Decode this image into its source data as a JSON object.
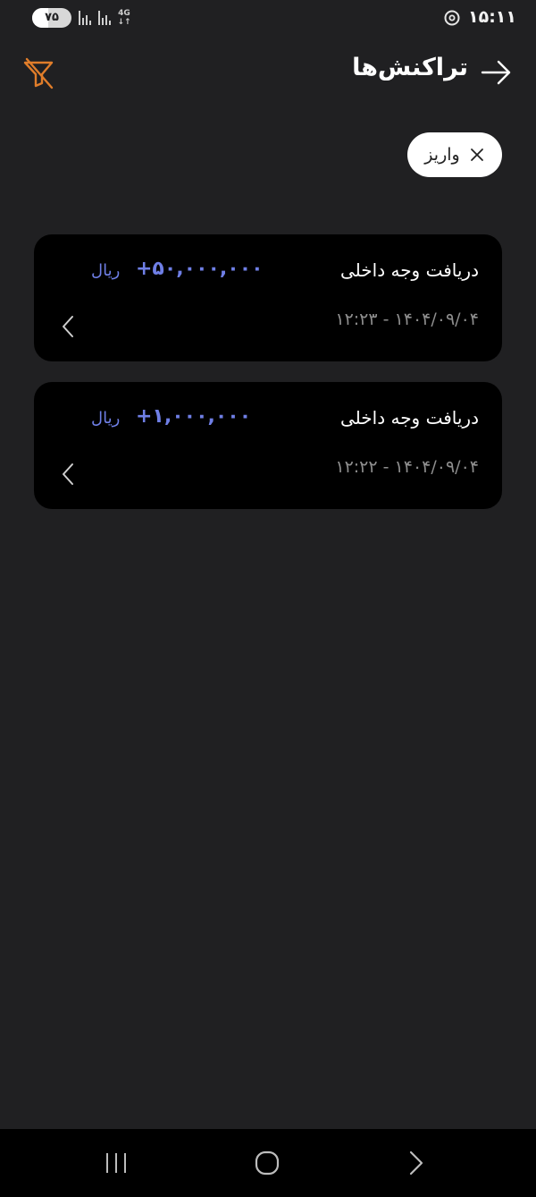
{
  "status_bar": {
    "battery": "۷۵",
    "network_type": "4G",
    "time": "۱۵:۱۱"
  },
  "header": {
    "title": "تراکنش‌ها",
    "back_icon": "arrow-right-icon",
    "filter_icon": "filter-off-icon"
  },
  "filters": {
    "chip_label": "واریز",
    "chip_close_icon": "close-icon"
  },
  "transactions": [
    {
      "title": "دریافت وجه داخلی",
      "amount": "+۵۰,۰۰۰,۰۰۰",
      "currency": "ریال",
      "datetime": "۱۴۰۴/۰۹/۰۴ - ۱۲:۲۳"
    },
    {
      "title": "دریافت وجه داخلی",
      "amount": "+۱,۰۰۰,۰۰۰",
      "currency": "ریال",
      "datetime": "۱۴۰۴/۰۹/۰۴ - ۱۲:۲۲"
    }
  ],
  "colors": {
    "background": "#202022",
    "card": "#000000",
    "accent_amount": "#6f7fe6",
    "filter_icon": "#e07d2a"
  },
  "nav_bar": {
    "recents_icon": "recents-icon",
    "home_icon": "home-icon",
    "back_icon": "back-chevron-icon"
  }
}
